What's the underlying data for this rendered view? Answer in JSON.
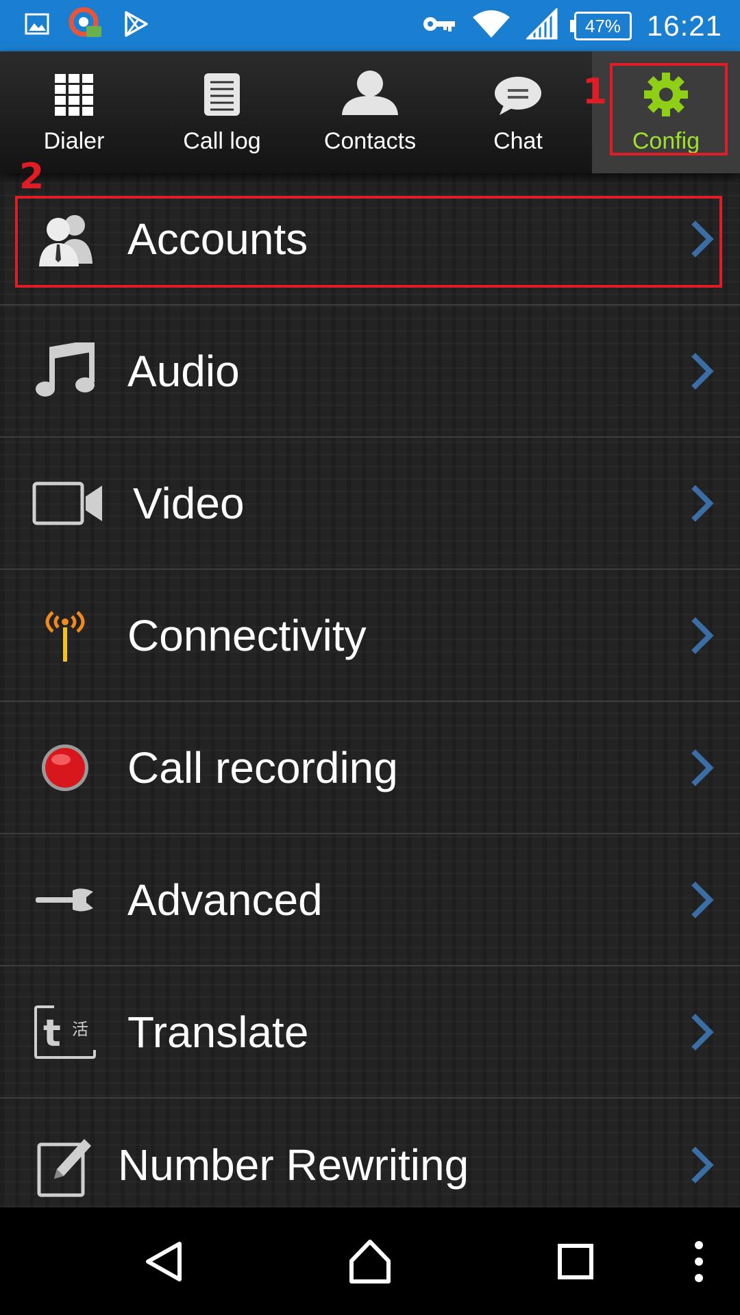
{
  "status_bar": {
    "left_icons": [
      "image-icon",
      "vpn-app-icon",
      "play-store-icon"
    ],
    "right_icons": [
      "key-icon",
      "wifi-icon",
      "signal-icon",
      "battery-icon"
    ],
    "battery": "47%",
    "time": "16:21"
  },
  "tabs": [
    {
      "label": "Dialer",
      "icon": "dialpad-icon"
    },
    {
      "label": "Call log",
      "icon": "call-log-icon"
    },
    {
      "label": "Contacts",
      "icon": "contacts-icon"
    },
    {
      "label": "Chat",
      "icon": "chat-icon"
    },
    {
      "label": "Config",
      "icon": "gear-icon",
      "active": true
    }
  ],
  "annotations": {
    "first": "1",
    "second": "2",
    "color": "#e01c24"
  },
  "menu": [
    {
      "label": "Accounts",
      "icon": "accounts-icon"
    },
    {
      "label": "Audio",
      "icon": "music-note-icon"
    },
    {
      "label": "Video",
      "icon": "video-camera-icon"
    },
    {
      "label": "Connectivity",
      "icon": "antenna-icon"
    },
    {
      "label": "Call recording",
      "icon": "record-icon"
    },
    {
      "label": "Advanced",
      "icon": "wrench-icon"
    },
    {
      "label": "Translate",
      "icon": "translate-icon"
    },
    {
      "label": "Number Rewriting",
      "icon": "edit-icon"
    }
  ],
  "nav_bar": [
    "back-icon",
    "home-icon",
    "recents-icon",
    "more-icon"
  ],
  "colors": {
    "status_bar": "#1a7fd1",
    "active_tab_text": "#9ee02a",
    "chevron": "#3a6ea5",
    "highlight": "#e01c24"
  }
}
